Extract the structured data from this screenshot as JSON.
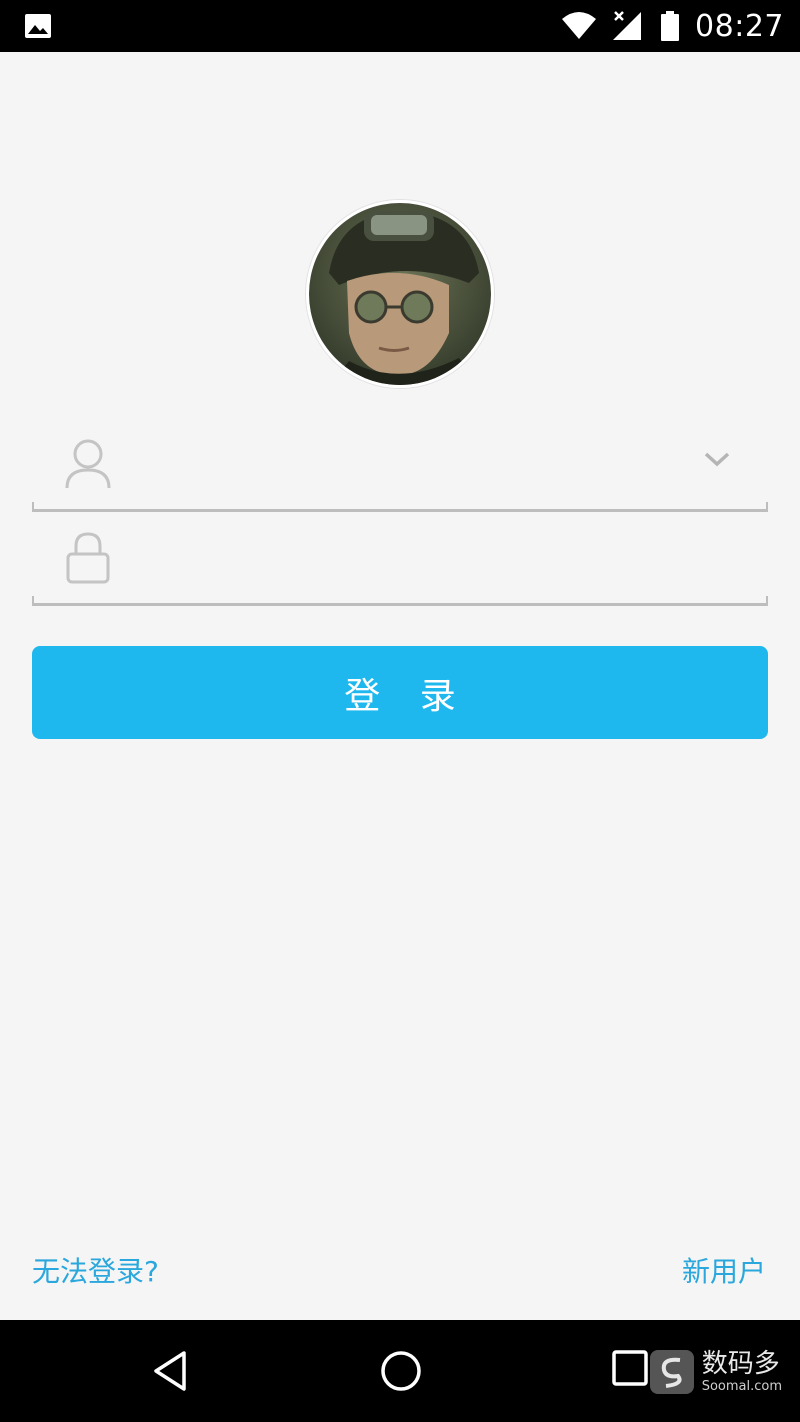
{
  "status_bar": {
    "time": "08:27",
    "icons": [
      "gallery-icon",
      "wifi-icon",
      "cellular-signal-icon",
      "battery-icon"
    ]
  },
  "login": {
    "avatar": "avatar-image",
    "username_field": {
      "value": "",
      "placeholder": "",
      "icon": "user-icon",
      "dropdown_icon": "chevron-down-icon"
    },
    "password_field": {
      "value": "",
      "placeholder": "",
      "icon": "lock-icon"
    },
    "login_button_label": "登 录"
  },
  "links": {
    "cannot_login": "无法登录?",
    "new_user": "新用户"
  },
  "nav_bar": {
    "icons": [
      "back-icon",
      "home-icon",
      "recents-icon"
    ]
  },
  "watermark": {
    "brand": "数码多",
    "site": "Soomal.com"
  },
  "colors": {
    "accent": "#1fb8ee",
    "link": "#2aa7dc",
    "background": "#f5f5f5",
    "underline": "#bdbdbd"
  }
}
